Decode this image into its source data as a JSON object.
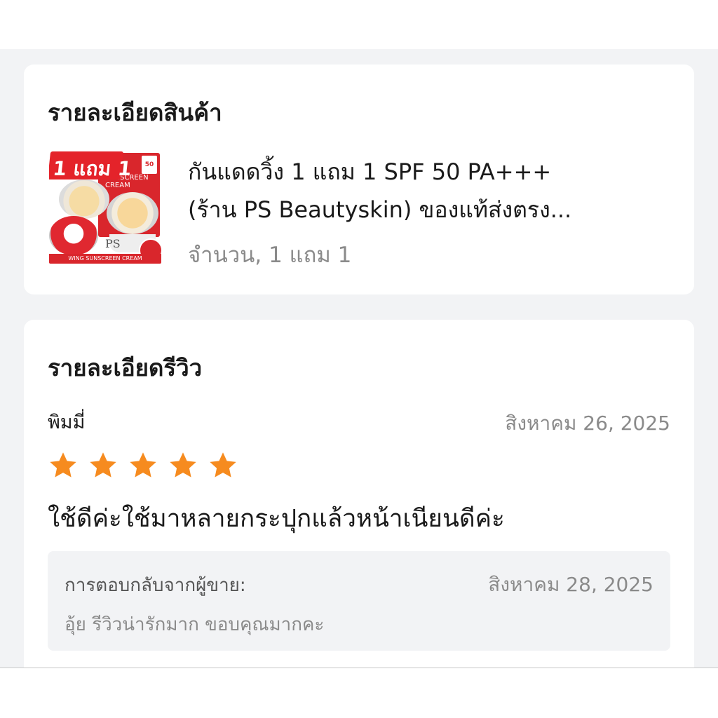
{
  "product_section": {
    "title": "รายละเอียดสินค้า",
    "product": {
      "name_line1": "กันแดดวิ้ง 1 แถม 1 SPF 50 PA+++",
      "name_line2": "(ร้าน PS Beautyskin) ของแท้ส่งตรง...",
      "quantity": "จำนวน, 1 แถม 1",
      "image": {
        "badge_text": "1 แถม 1",
        "box_label": "SUNSCREEN\nCREAM",
        "spf_badge": "50",
        "footer_text": "WING SUNSCREEN CREAM",
        "ps_text": "PS",
        "brand_color": "#d9262c"
      }
    }
  },
  "review_section": {
    "title": "รายละเอียดรีวิว",
    "reviewer_name": "พิมมี่",
    "review_date": "สิงหาคม 26, 2025",
    "rating": 5,
    "rating_max": 5,
    "star_color": "#f68b1f",
    "review_text": "ใช้ดีค่ะใช้มาหลายกระปุกแล้วหน้าเนียนดีค่ะ",
    "seller_reply": {
      "label": "การตอบกลับจากผู้ขาย:",
      "date": "สิงหาคม 28, 2025",
      "text": "อุ้ย รีวิวน่ารักมาก ขอบคุณมากคะ"
    }
  }
}
